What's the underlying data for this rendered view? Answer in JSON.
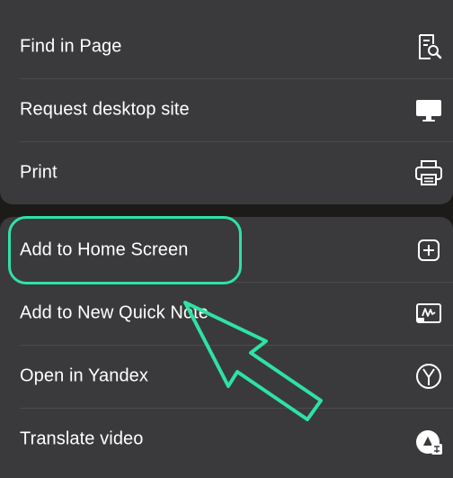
{
  "menu": {
    "group1": [
      {
        "label": "Find in Page",
        "icon": "find-in-page-icon"
      },
      {
        "label": "Request desktop site",
        "icon": "desktop-monitor-icon"
      },
      {
        "label": "Print",
        "icon": "printer-icon"
      }
    ],
    "group2": [
      {
        "label": "Add to Home Screen",
        "icon": "add-square-icon"
      },
      {
        "label": "Add to New Quick Note",
        "icon": "quick-note-icon"
      },
      {
        "label": "Open in Yandex",
        "icon": "yandex-icon"
      },
      {
        "label": "Translate video",
        "icon": "translate-video-icon"
      }
    ]
  },
  "colors": {
    "menu_background": "#3a3a3c",
    "page_background": "#1c1b1a",
    "annotation": "#2ee2a4"
  }
}
